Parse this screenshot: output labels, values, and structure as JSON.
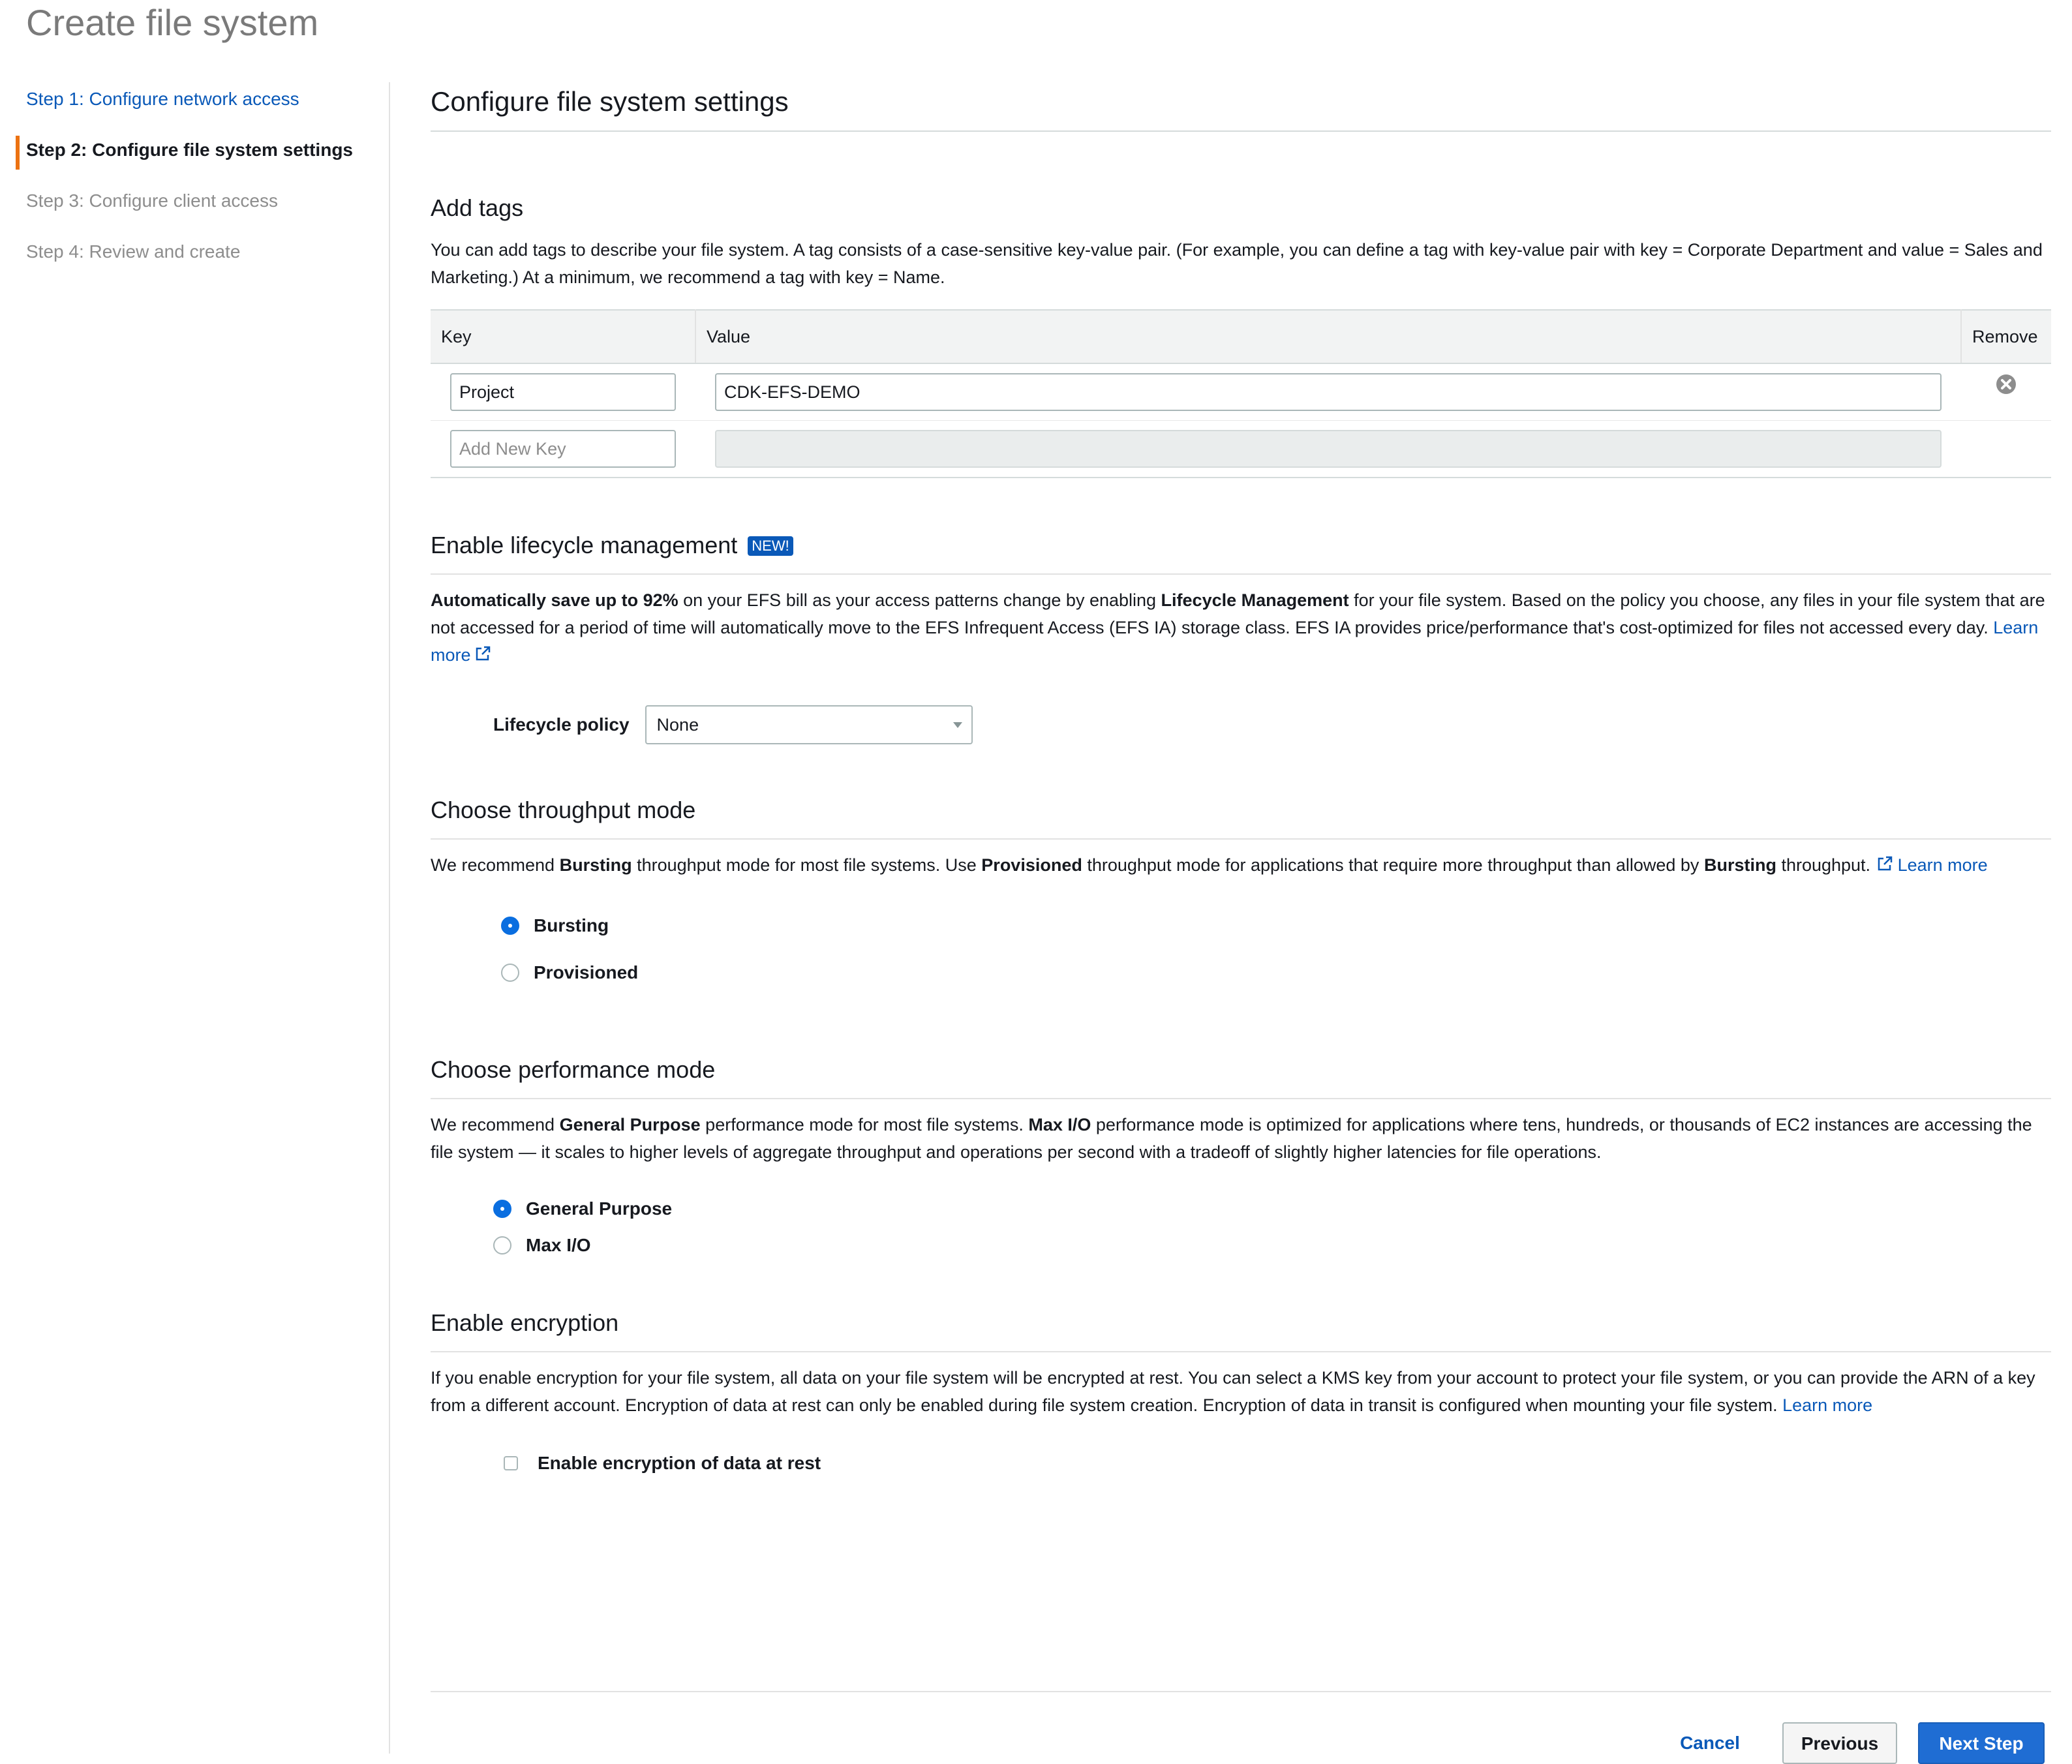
{
  "page": {
    "title": "Create file system"
  },
  "steps": [
    {
      "label": "Step 1: Configure network access"
    },
    {
      "label": "Step 2: Configure file system settings"
    },
    {
      "label": "Step 3: Configure client access"
    },
    {
      "label": "Step 4: Review and create"
    }
  ],
  "main": {
    "title": "Configure file system settings"
  },
  "tags": {
    "heading": "Add tags",
    "description": "You can add tags to describe your file system. A tag consists of a case-sensitive key-value pair. (For example, you can define a tag with key-value pair with key = Corporate Department and value = Sales and Marketing.) At a minimum, we recommend a tag with key = Name.",
    "columns": {
      "key": "Key",
      "value": "Value",
      "remove": "Remove"
    },
    "rows": [
      {
        "key": "Project",
        "value": "CDK-EFS-DEMO"
      }
    ],
    "new_key_placeholder": "Add New Key"
  },
  "lifecycle": {
    "heading": "Enable lifecycle management",
    "badge": "NEW!",
    "desc_bold1": "Automatically save up to 92%",
    "desc_text1": " on your EFS bill as your access patterns change by enabling ",
    "desc_bold2": "Lifecycle Management",
    "desc_text2": " for your file system. Based on the policy you choose, any files in your file system that are not accessed for a period of time will automatically move to the EFS Infrequent Access (EFS IA) storage class. EFS IA provides price/performance that's cost-optimized for files not accessed every day. ",
    "learn_more": "Learn more",
    "policy_label": "Lifecycle policy",
    "policy_value": "None"
  },
  "throughput": {
    "heading": "Choose throughput mode",
    "desc_t1": "We recommend ",
    "desc_b1": "Bursting",
    "desc_t2": " throughput mode for most file systems. Use ",
    "desc_b2": "Provisioned",
    "desc_t3": " throughput mode for applications that require more throughput than allowed by ",
    "desc_b3": "Bursting",
    "desc_t4": " throughput. ",
    "learn_more": "Learn more",
    "options": [
      {
        "label": "Bursting"
      },
      {
        "label": "Provisioned"
      }
    ],
    "selected": "Bursting"
  },
  "performance": {
    "heading": "Choose performance mode",
    "desc_t1": "We recommend ",
    "desc_b1": "General Purpose",
    "desc_t2": " performance mode for most file systems. ",
    "desc_b2": "Max I/O",
    "desc_t3": " performance mode is optimized for applications where tens, hundreds, or thousands of EC2 instances are accessing the file system — it scales to higher levels of aggregate throughput and operations per second with a tradeoff of slightly higher latencies for file operations.",
    "options": [
      {
        "label": "General Purpose"
      },
      {
        "label": "Max I/O"
      }
    ],
    "selected": "General Purpose"
  },
  "encryption": {
    "heading": "Enable encryption",
    "description": "If you enable encryption for your file system, all data on your file system will be encrypted at rest. You can select a KMS key from your account to protect your file system, or you can provide the ARN of a key from a different account. Encryption of data at rest can only be enabled during file system creation. Encryption of data in transit is configured when mounting your file system. ",
    "learn_more": "Learn more",
    "checkbox_label": "Enable encryption of data at rest",
    "checked": false
  },
  "footer": {
    "cancel": "Cancel",
    "previous": "Previous",
    "next": "Next Step"
  },
  "colors": {
    "link": "#0a59b8",
    "accent": "#ec7211",
    "primary_button": "#1f6dd3",
    "radio_selected": "#0a6ee0"
  }
}
